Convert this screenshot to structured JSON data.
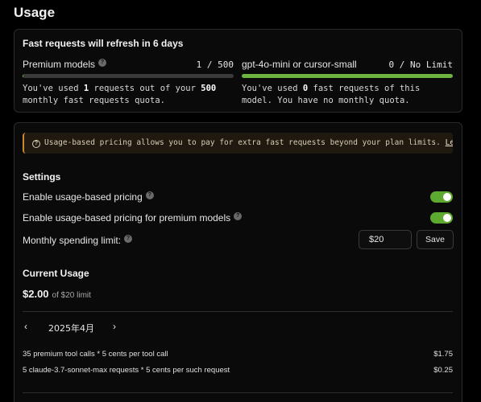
{
  "page": {
    "title": "Usage"
  },
  "fast_requests": {
    "title": "Fast requests will refresh in 6 days",
    "premium": {
      "name": "Premium models",
      "count": "1 / 500",
      "progress": 0.002,
      "desc_prefix": "You've used ",
      "desc_used": "1",
      "desc_mid": " requests out of your ",
      "desc_total": "500",
      "desc_suffix": " monthly fast requests quota."
    },
    "mini": {
      "name": "gpt-4o-mini or cursor-small",
      "count": "0 / No Limit",
      "progress": 1.0,
      "desc_prefix": "You've used ",
      "desc_used": "0",
      "desc_suffix": " fast requests of this model. You have no monthly quota."
    }
  },
  "notice": {
    "text": "Usage-based pricing allows you to pay for extra fast requests beyond your plan limits.",
    "link": "Learn more"
  },
  "settings": {
    "title": "Settings",
    "usage_based": {
      "label": "Enable usage-based pricing",
      "enabled": true
    },
    "usage_based_premium": {
      "label": "Enable usage-based pricing for premium models",
      "enabled": true
    },
    "spending_limit": {
      "label": "Monthly spending limit:",
      "value": "$20",
      "save_label": "Save"
    }
  },
  "current_usage": {
    "title": "Current Usage",
    "amount": "$2.00",
    "limit_text": "of $20 limit",
    "month": "2025年4月",
    "items": [
      {
        "description": "35 premium tool calls * 5 cents per tool call",
        "amount": "$1.75"
      },
      {
        "description": "5 claude-3.7-sonnet-max requests * 5 cents per such request",
        "amount": "$0.25"
      }
    ]
  },
  "colors": {
    "accent_green": "#5ea92f",
    "notice_border": "#c98a2b"
  }
}
